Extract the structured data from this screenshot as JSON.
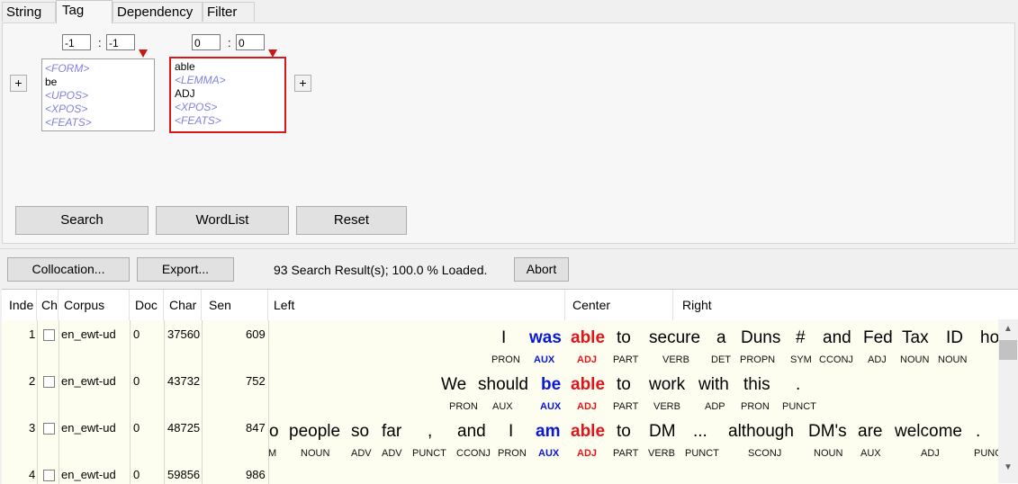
{
  "tabs": [
    {
      "label": "String"
    },
    {
      "label": "Tag"
    },
    {
      "label": "Dependency"
    },
    {
      "label": "Filter"
    }
  ],
  "query": {
    "slot1": {
      "range_from": "-1",
      "range_to": "-1",
      "form": "<FORM>",
      "lemma": "be",
      "upos": "<UPOS>",
      "xpos": "<XPOS>",
      "feats": "<FEATS>"
    },
    "slot2": {
      "range_from": "0",
      "range_to": "0",
      "form": "able",
      "lemma": "<LEMMA>",
      "upos": "ADJ",
      "xpos": "<XPOS>",
      "feats": "<FEATS>"
    },
    "colon": ":",
    "add_left_label": "+",
    "add_right_label": "+"
  },
  "buttons": {
    "search": "Search",
    "wordlist": "WordList",
    "reset": "Reset",
    "collocation": "Collocation...",
    "export": "Export...",
    "abort": "Abort"
  },
  "status": "93 Search Result(s);  100.0 % Loaded.",
  "columns": [
    "Inde",
    "Ch",
    "Corpus",
    "Doc",
    "Char",
    "Sen",
    "Left",
    "Center",
    "Right"
  ],
  "rows": [
    {
      "index": "1",
      "corpus": "en_ewt-ud",
      "doc": "0",
      "char": "37560",
      "sen": "609",
      "left": [
        [
          "I",
          "PRON"
        ],
        [
          "was",
          "AUX"
        ]
      ],
      "center": [
        [
          "able",
          "ADJ"
        ]
      ],
      "right": [
        [
          "to",
          "PART"
        ],
        [
          "secure",
          "VERB"
        ],
        [
          "a",
          "DET"
        ],
        [
          "Duns",
          "PROPN"
        ],
        [
          "#",
          "SYM"
        ],
        [
          "and",
          "CCONJ"
        ],
        [
          "Fed",
          "ADJ"
        ],
        [
          "Tax",
          "NOUN"
        ],
        [
          "ID",
          "NOUN"
        ],
        [
          "ho",
          ""
        ]
      ]
    },
    {
      "index": "2",
      "corpus": "en_ewt-ud",
      "doc": "0",
      "char": "43732",
      "sen": "752",
      "left": [
        [
          "We",
          "PRON"
        ],
        [
          "should",
          "AUX"
        ],
        [
          "be",
          "AUX"
        ]
      ],
      "center": [
        [
          "able",
          "ADJ"
        ]
      ],
      "right": [
        [
          "to",
          "PART"
        ],
        [
          "work",
          "VERB"
        ],
        [
          "with",
          "ADP"
        ],
        [
          "this",
          "PRON"
        ],
        [
          ".",
          "PUNCT"
        ]
      ]
    },
    {
      "index": "3",
      "corpus": "en_ewt-ud",
      "doc": "0",
      "char": "48725",
      "sen": "847",
      "left": [
        [
          "o",
          "M"
        ],
        [
          "people",
          "NOUN"
        ],
        [
          "so",
          "ADV"
        ],
        [
          "far",
          "ADV"
        ],
        [
          ",",
          "PUNCT"
        ],
        [
          "and",
          "CCONJ"
        ],
        [
          "I",
          "PRON"
        ],
        [
          "am",
          "AUX"
        ]
      ],
      "center": [
        [
          "able",
          "ADJ"
        ]
      ],
      "right": [
        [
          "to",
          "PART"
        ],
        [
          "DM",
          "VERB"
        ],
        [
          "...",
          "PUNCT"
        ],
        [
          "although",
          "SCONJ"
        ],
        [
          "DM's",
          "NOUN"
        ],
        [
          "are",
          "AUX"
        ],
        [
          "welcome",
          "ADJ"
        ],
        [
          ".",
          "PUNC"
        ]
      ]
    },
    {
      "index": "4",
      "corpus": "en_ewt-ud",
      "doc": "0",
      "char": "59856",
      "sen": "986"
    }
  ]
}
